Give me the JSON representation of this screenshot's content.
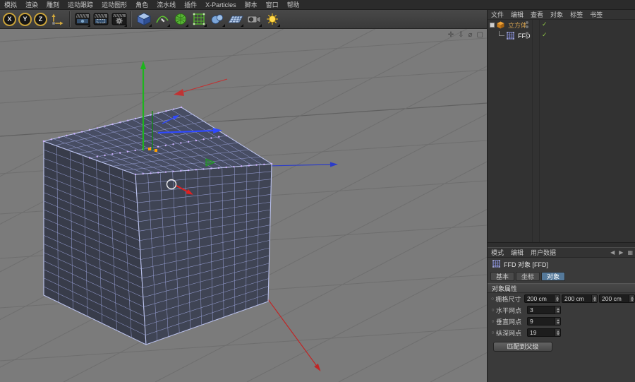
{
  "menubar": {
    "items": [
      "模拟",
      "渲染",
      "雕刻",
      "运动跟踪",
      "运动图形",
      "角色",
      "流水线",
      "插件",
      "X-Particles",
      "脚本",
      "窗口",
      "帮助"
    ]
  },
  "toolbar": {
    "axis_buttons": [
      {
        "name": "axis-x-lock-button",
        "label": "X"
      },
      {
        "name": "axis-y-lock-button",
        "label": "Y"
      },
      {
        "name": "axis-z-lock-button",
        "label": "Z"
      }
    ],
    "icon_names": [
      "coordinate-system-icon",
      "render-view-icon",
      "render-region-icon",
      "render-settings-icon",
      "primitive-cube-icon",
      "spline-pen-icon",
      "subdivision-surface-icon",
      "deformer-icon",
      "volume-icon",
      "floor-icon",
      "camera-icon",
      "light-icon"
    ]
  },
  "viewport": {
    "nav_icons": [
      {
        "name": "pan-view-icon",
        "glyph": "✛"
      },
      {
        "name": "dolly-view-icon",
        "glyph": "⇩"
      },
      {
        "name": "rotate-view-icon",
        "glyph": "⌀"
      },
      {
        "name": "toggle-view-icon",
        "glyph": "▢"
      }
    ],
    "colors": {
      "background": "#7b7b7b",
      "grid": "#6e6e6e",
      "axis_x": "#e02020",
      "axis_y": "#1db51d",
      "axis_z": "#2f49ff",
      "wireframe": "#9aa2d8",
      "face_left": "#383c4a",
      "face_right": "#3f4454",
      "face_top": "#474d63",
      "lattice_dot": "#cdb2ff",
      "handle": "#ffa000"
    }
  },
  "object_manager": {
    "menu": [
      "文件",
      "编辑",
      "查看",
      "对象",
      "标签",
      "书签"
    ],
    "objects": [
      {
        "label": "立方体",
        "icon": "cube",
        "icon_name": "cube-object-icon",
        "indent": 0,
        "label_color": "#d2a050"
      },
      {
        "label": "FFD",
        "icon": "ffd",
        "icon_name": "ffd-object-icon",
        "indent": 1,
        "label_color": "#f2f2f2"
      }
    ]
  },
  "attribute_manager": {
    "menu": [
      "模式",
      "编辑",
      "用户数据"
    ],
    "title": "FFD 对象 [FFD]",
    "tabs": [
      "基本",
      "坐标",
      "对象"
    ],
    "active_tab_index": 2,
    "section": "对象属性",
    "rows": [
      {
        "label": "栅格尺寸",
        "values": [
          "200 cm",
          "200 cm",
          "200 cm"
        ]
      },
      {
        "label": "水平网点",
        "values": [
          "3"
        ]
      },
      {
        "label": "垂直网点",
        "values": [
          "9"
        ]
      },
      {
        "label": "纵深网点",
        "values": [
          "19"
        ]
      }
    ],
    "match_parent_button": "匹配到父级"
  }
}
